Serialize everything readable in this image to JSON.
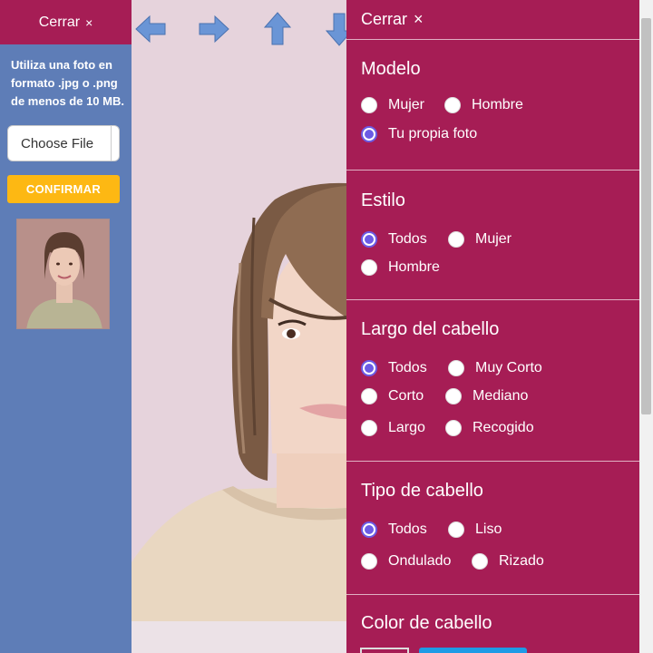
{
  "left_panel": {
    "close_label": "Cerrar",
    "close_icon": "×",
    "upload_help": "Utiliza una foto en formato .jpg o .png de menos de 10 MB.",
    "file_button_label": "Choose File",
    "confirm_label": "CONFIRMAR"
  },
  "arrows": [
    "arrow-left-icon",
    "arrow-right-icon",
    "arrow-up-icon",
    "arrow-down-icon"
  ],
  "right_panel": {
    "close_label": "Cerrar",
    "close_icon": "×",
    "sections": [
      {
        "title": "Modelo",
        "options": [
          {
            "label": "Mujer",
            "checked": false
          },
          {
            "label": "Hombre",
            "checked": false
          },
          {
            "label": "Tu propia foto",
            "checked": true
          }
        ]
      },
      {
        "title": "Estilo",
        "options": [
          {
            "label": "Todos",
            "checked": true
          },
          {
            "label": "Mujer",
            "checked": false
          },
          {
            "label": "Hombre",
            "checked": false
          }
        ]
      },
      {
        "title": "Largo del cabello",
        "options": [
          {
            "label": "Todos",
            "checked": true
          },
          {
            "label": "Muy Corto",
            "checked": false
          },
          {
            "label": "Corto",
            "checked": false
          },
          {
            "label": "Mediano",
            "checked": false
          },
          {
            "label": "Largo",
            "checked": false
          },
          {
            "label": "Recogido",
            "checked": false
          }
        ]
      },
      {
        "title": "Tipo de cabello",
        "options": [
          {
            "label": "Todos",
            "checked": true
          },
          {
            "label": "Liso",
            "checked": false
          },
          {
            "label": "Ondulado",
            "checked": false
          },
          {
            "label": "Rizado",
            "checked": false
          }
        ]
      },
      {
        "title": "Color de cabello",
        "options": []
      }
    ]
  },
  "colors": {
    "panel_magenta": "#a61d55",
    "left_blue": "#5e7db7",
    "confirm_yellow": "#fdb813",
    "radio_accent": "#6b5be4",
    "stage_pink": "#e6d3dc"
  }
}
